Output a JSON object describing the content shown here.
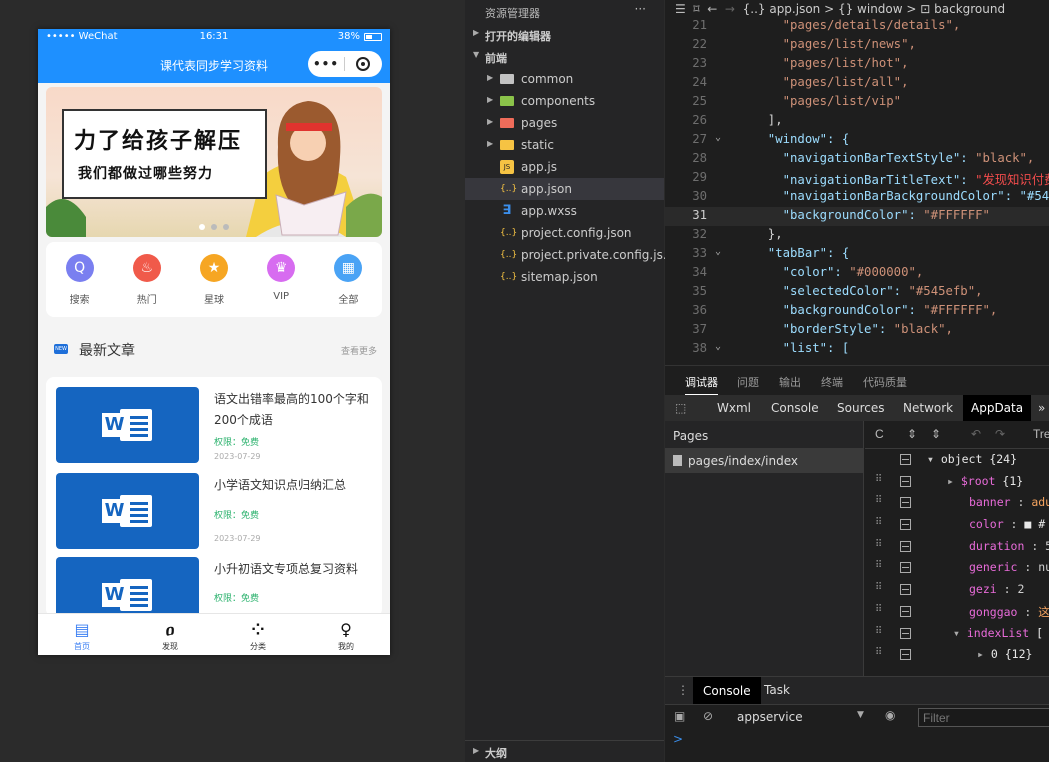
{
  "phone": {
    "status": {
      "carrier": "••••• WeChat",
      "time": "16:31",
      "battery": "38%"
    },
    "nav_title": "课代表同步学习资料",
    "capsule": {
      "menu": "•••"
    },
    "banner": {
      "line1": "力了给孩子解压",
      "line2": "我们都做过哪些努力"
    },
    "grid": [
      {
        "label": "搜索",
        "color": "#7a7ff0",
        "icon": "search-icon",
        "glyph": "Q"
      },
      {
        "label": "热门",
        "color": "#f05a4a",
        "icon": "fire-icon",
        "glyph": "♨"
      },
      {
        "label": "星球",
        "color": "#f6a623",
        "icon": "star-icon",
        "glyph": "★"
      },
      {
        "label": "VIP",
        "color": "#d76cf0",
        "icon": "crown-icon",
        "glyph": "♛"
      },
      {
        "label": "全部",
        "color": "#4aa3f5",
        "icon": "grid-icon",
        "glyph": "▦"
      }
    ],
    "section": {
      "badge": "NEW",
      "title": "最新文章",
      "more": "查看更多"
    },
    "articles": [
      {
        "title": "语文出错率最高的100个字和200个成语",
        "perm": "权限：免费",
        "date": "2023-07-29"
      },
      {
        "title": "小学语文知识点归纳汇总",
        "perm": "权限：免费",
        "date": "2023-07-29"
      },
      {
        "title": "小升初语文专项总复习资料",
        "perm": "权限：免费",
        "date": ""
      }
    ],
    "tabs": [
      {
        "label": "首页",
        "icon": "home-icon",
        "glyph": "▤"
      },
      {
        "label": "发现",
        "icon": "discover-icon",
        "glyph": "ዐ"
      },
      {
        "label": "分类",
        "icon": "category-icon",
        "glyph": "⁘"
      },
      {
        "label": "我的",
        "icon": "profile-icon",
        "glyph": "♀"
      }
    ]
  },
  "explorer": {
    "title": "资源管理器",
    "more": "···",
    "open_editors": "打开的编辑器",
    "project": "前端",
    "items": [
      {
        "name": "common",
        "type": "folder"
      },
      {
        "name": "components",
        "type": "folder"
      },
      {
        "name": "pages",
        "type": "folder"
      },
      {
        "name": "static",
        "type": "folder"
      },
      {
        "name": "app.js",
        "type": "js"
      },
      {
        "name": "app.json",
        "type": "json"
      },
      {
        "name": "app.wxss",
        "type": "css"
      },
      {
        "name": "project.config.json",
        "type": "json"
      },
      {
        "name": "project.private.config.js...",
        "type": "json"
      },
      {
        "name": "sitemap.json",
        "type": "json"
      }
    ],
    "outline": "大纲"
  },
  "editor": {
    "breadcrumb": "{..} app.json > {} window > ⊡ background",
    "lines": [
      {
        "n": "21",
        "text": "    \"pages/details/details\","
      },
      {
        "n": "22",
        "text": "    \"pages/list/news\","
      },
      {
        "n": "23",
        "text": "    \"pages/list/hot\","
      },
      {
        "n": "24",
        "text": "    \"pages/list/all\","
      },
      {
        "n": "25",
        "text": "    \"pages/list/vip\""
      },
      {
        "n": "26",
        "text": "  ],"
      },
      {
        "n": "27",
        "text": "  \"window\": {"
      },
      {
        "n": "28",
        "text": "    \"navigationBarTextStyle\": \"black\","
      },
      {
        "n": "29",
        "text": "    \"navigationBarTitleText\": \"发现知识付费"
      },
      {
        "n": "30",
        "text": "    \"navigationBarBackgroundColor\": \"#545"
      },
      {
        "n": "31",
        "text": "    \"backgroundColor\": \"#FFFFFF\""
      },
      {
        "n": "32",
        "text": "  },"
      },
      {
        "n": "33",
        "text": "  \"tabBar\": {"
      },
      {
        "n": "34",
        "text": "    \"color\": \"#000000\","
      },
      {
        "n": "35",
        "text": "    \"selectedColor\": \"#545efb\","
      },
      {
        "n": "36",
        "text": "    \"backgroundColor\": \"#FFFFFF\","
      },
      {
        "n": "37",
        "text": "    \"borderStyle\": \"black\","
      },
      {
        "n": "38",
        "text": "    \"list\": ["
      }
    ]
  },
  "debugger": {
    "tabs": [
      "调试器",
      "问题",
      "输出",
      "终端",
      "代码质量"
    ],
    "devtools_tabs": [
      "Wxml",
      "Console",
      "Sources",
      "Network",
      "AppData",
      "»"
    ],
    "pages_header": "Pages",
    "page_item": "pages/index/index",
    "tree_label": "Tre",
    "data_rows": [
      {
        "key": "object {24}",
        "value": "",
        "indent": 0,
        "arrow": "▾"
      },
      {
        "key": "$root",
        "value": "{1}",
        "indent": 1,
        "arrow": "▸"
      },
      {
        "key": "banner",
        "value": "adu",
        "indent": 1,
        "arrow": ""
      },
      {
        "key": "color",
        "value": "■ #",
        "indent": 1,
        "arrow": ""
      },
      {
        "key": "duration",
        "value": "5",
        "indent": 1,
        "arrow": ""
      },
      {
        "key": "generic",
        "value": "nu",
        "indent": 1,
        "arrow": ""
      },
      {
        "key": "gezi",
        "value": "2",
        "indent": 1,
        "arrow": ""
      },
      {
        "key": "gonggao",
        "value": "这",
        "indent": 1,
        "arrow": ""
      },
      {
        "key": "indexList",
        "value": "[",
        "indent": 1,
        "arrow": "▾"
      },
      {
        "key": "0",
        "value": "{12}",
        "indent": 2,
        "arrow": "▸"
      }
    ],
    "console_tabs": [
      "Console",
      "Task"
    ],
    "context": "appservice",
    "filter_placeholder": "Filter",
    "prompt": ">"
  }
}
